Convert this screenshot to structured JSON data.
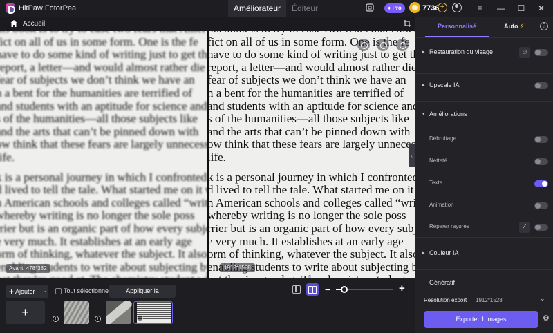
{
  "titlebar": {
    "app_title": "HitPaw FotorPea",
    "tabs": [
      {
        "label": "Améliorateur",
        "active": true
      },
      {
        "label": "Éditeur",
        "active": false
      }
    ],
    "pro_label": "Pro",
    "credits": "7736"
  },
  "homebar": {
    "home_label": "Accueil"
  },
  "canvas": {
    "document_lines": [
      "his book is to try to ease two fears that Amer",
      "fict on all of us in some form. One is the fe",
      "have to do some kind of writing just to get th",
      "report, a letter—and would almost rather die t",
      "fear of subjects we don’t think we have an",
      "n a bent for the humanities are terrified of",
      "and students with an aptitude for science and",
      "s of the humanities—all those subjects like",
      "and the arts that can’t be pinned down with",
      "ow think that these fears are largely unnecessa",
      "life.",
      "",
      "k is a personal journey in which I confronted",
      "d lived to tell the tale. What started me on it w",
      "n American schools and colleges called “writ",
      "whereby writing is no longer the sole poss",
      "rrier but is an organic part of how every subjec",
      "e very much. It establishes at an early age",
      "orm of thinking, whatever the subject. It also m",
      "enabling students to write about subjecting by enabling students to write about subject",
      "hat they’re good at. The chemistry student who"
    ],
    "before_label": "Avant: 478*382",
    "after_label": "1912*1528"
  },
  "bottom": {
    "add_label": "Ajouter",
    "select_all_label": "Tout sélectionner",
    "apply_label": "Appliquer la combinaison.",
    "zoom_level": 0.15
  },
  "panel": {
    "tab_custom": "Personnalisé",
    "tab_auto": "Auto",
    "sections": {
      "face_restore": "Restauration du visage",
      "upscale": "Upscale IA",
      "improvements": "Améliorations",
      "denoise": "Débruitage",
      "sharpness": "Netteté",
      "text": "Texte",
      "animation": "Animation",
      "scratch": "Réparer rayures",
      "color": "Couleur IA",
      "generative": "Génératif"
    },
    "export_label": "Résolution export :",
    "export_resolution": "1912*1528",
    "export_button": "Exporter 1 images"
  },
  "colors": {
    "accent": "#6d5cf0",
    "accent_text": "#8f7cff",
    "coin": "#f0b429"
  }
}
